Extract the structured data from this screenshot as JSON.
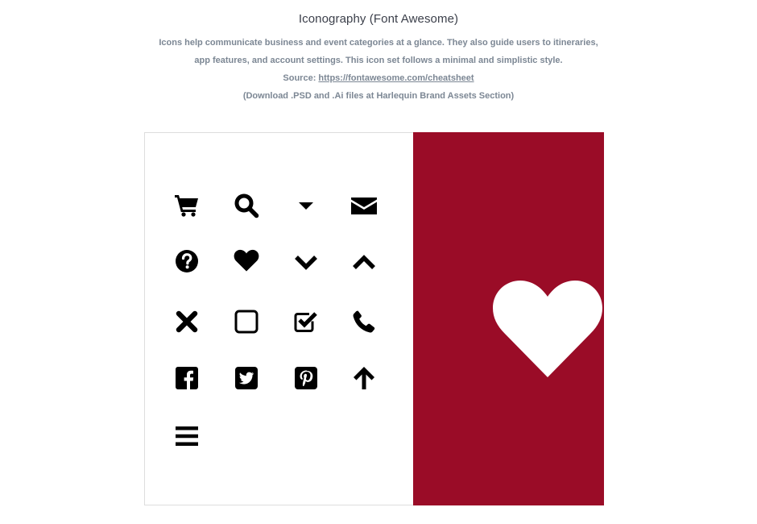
{
  "header": {
    "title": "Iconography (Font Awesome)",
    "line1": "Icons help communicate business and event categories at a glance. They also guide users to itineraries,",
    "line2": "app features, and account settings. This icon set follows a minimal and simplistic style.",
    "source_label": "Source: ",
    "source_link": "https://fontawesome.com/cheatsheet",
    "line4": "(Download .PSD and .Ai files at Harlequin Brand Assets Section)"
  },
  "colors": {
    "accent_red": "#9a0c27",
    "icon": "#000000",
    "text_muted": "#7c8794",
    "title": "#3b3f4a"
  },
  "icons": [
    "shopping-cart-icon",
    "search-icon",
    "caret-down-icon",
    "envelope-icon",
    "question-circle-icon",
    "heart-icon",
    "chevron-down-icon",
    "chevron-up-icon",
    "close-icon",
    "square-outline-icon",
    "check-square-icon",
    "phone-icon",
    "facebook-square-icon",
    "twitter-square-icon",
    "pinterest-square-icon",
    "arrow-up-icon",
    "bars-icon"
  ],
  "feature_icon": "heart-icon"
}
